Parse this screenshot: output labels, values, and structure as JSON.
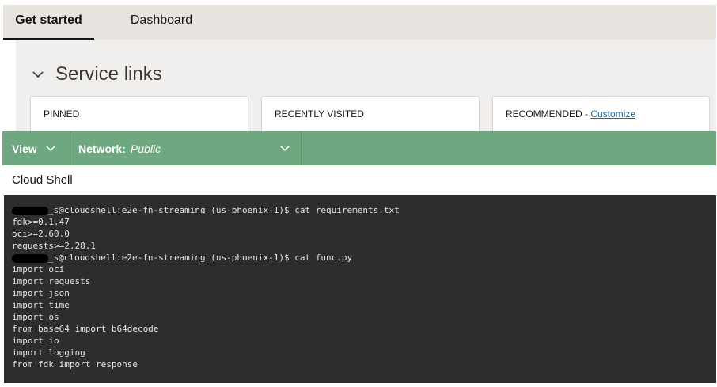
{
  "tabs": [
    {
      "label": "Get started",
      "active": true
    },
    {
      "label": "Dashboard",
      "active": false
    }
  ],
  "service_links": {
    "title": "Service links",
    "cards": [
      {
        "label": "PINNED"
      },
      {
        "label": "RECENTLY VISITED"
      },
      {
        "label": "RECOMMENDED - ",
        "link": "Customize"
      }
    ]
  },
  "shell_toolbar": {
    "view_label": "View",
    "network_label": "Network:",
    "network_value": "Public",
    "accent_color": "#6fa780"
  },
  "shell_title": "Cloud Shell",
  "terminal": {
    "lines": [
      {
        "redacted": true,
        "text": "_s@cloudshell:e2e-fn-streaming (us-phoenix-1)$ cat requirements.txt"
      },
      {
        "redacted": false,
        "text": "fdk>=0.1.47"
      },
      {
        "redacted": false,
        "text": "oci>=2.60.0"
      },
      {
        "redacted": false,
        "text": "requests>=2.28.1"
      },
      {
        "redacted": true,
        "text": "_s@cloudshell:e2e-fn-streaming (us-phoenix-1)$ cat func.py"
      },
      {
        "redacted": false,
        "text": "import oci"
      },
      {
        "redacted": false,
        "text": "import requests"
      },
      {
        "redacted": false,
        "text": "import json"
      },
      {
        "redacted": false,
        "text": "import time"
      },
      {
        "redacted": false,
        "text": "import os"
      },
      {
        "redacted": false,
        "text": "from base64 import b64decode"
      },
      {
        "redacted": false,
        "text": "import io"
      },
      {
        "redacted": false,
        "text": "import logging"
      },
      {
        "redacted": false,
        "text": "from fdk import response"
      }
    ]
  }
}
